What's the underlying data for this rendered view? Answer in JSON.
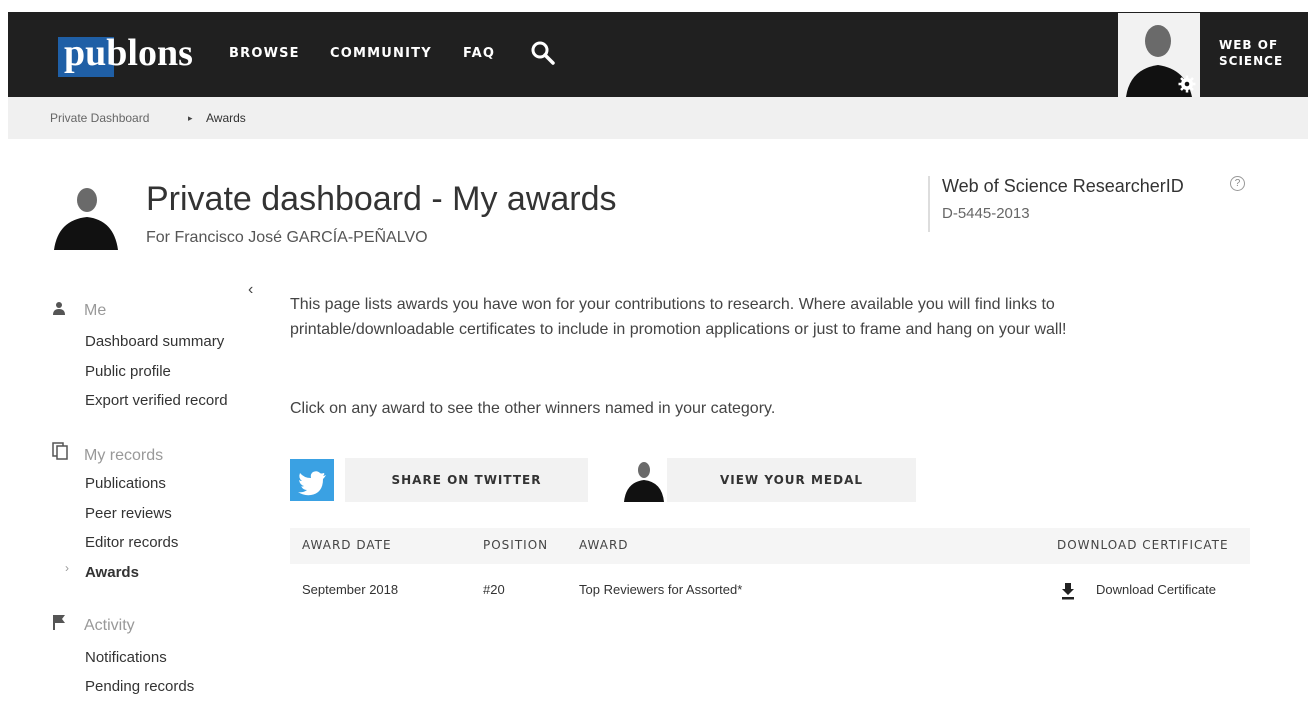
{
  "nav": {
    "logo": "publons",
    "links": [
      "BROWSE",
      "COMMUNITY",
      "FAQ"
    ],
    "wos_line1": "WEB OF",
    "wos_line2": "SCIENCE"
  },
  "breadcrumb": {
    "items": [
      "Private Dashboard",
      "Awards"
    ],
    "separator": "▸"
  },
  "header": {
    "title": "Private dashboard - My awards",
    "subtitle": "For Francisco José GARCÍA-PEÑALVO",
    "researcher_id_label": "Web of Science ResearcherID",
    "researcher_id_help": "?",
    "researcher_id": "D-5445-2013"
  },
  "sidebar": {
    "collapse": "‹",
    "sections": [
      {
        "title": "Me",
        "icon": "person-icon",
        "items": [
          "Dashboard summary",
          "Public profile",
          "Export verified record"
        ]
      },
      {
        "title": "My records",
        "icon": "copy-icon",
        "items": [
          "Publications",
          "Peer reviews",
          "Editor records",
          "Awards"
        ]
      },
      {
        "title": "Activity",
        "icon": "flag-icon",
        "items": [
          "Notifications",
          "Pending records"
        ]
      }
    ],
    "active_item": "Awards"
  },
  "main": {
    "intro": "This page lists awards you have won for your contributions to research. Where available you will find links to printable/downloadable certificates to include in promotion applications or just to frame and hang on your wall!",
    "click_text": "Click on any award to see the other winners named in your category.",
    "twitter_button": "SHARE ON TWITTER",
    "medal_button": "VIEW YOUR MEDAL"
  },
  "table": {
    "headers": [
      "AWARD DATE",
      "POSITION",
      "AWARD",
      "DOWNLOAD CERTIFICATE"
    ],
    "rows": [
      {
        "date": "September 2018",
        "position": "#20",
        "award": "Top Reviewers for Assorted*",
        "download": "Download Certificate"
      }
    ]
  },
  "colors": {
    "topbar": "#202020",
    "brand_blue": "#1f5fa6",
    "twitter_blue": "#3aa1e3"
  }
}
